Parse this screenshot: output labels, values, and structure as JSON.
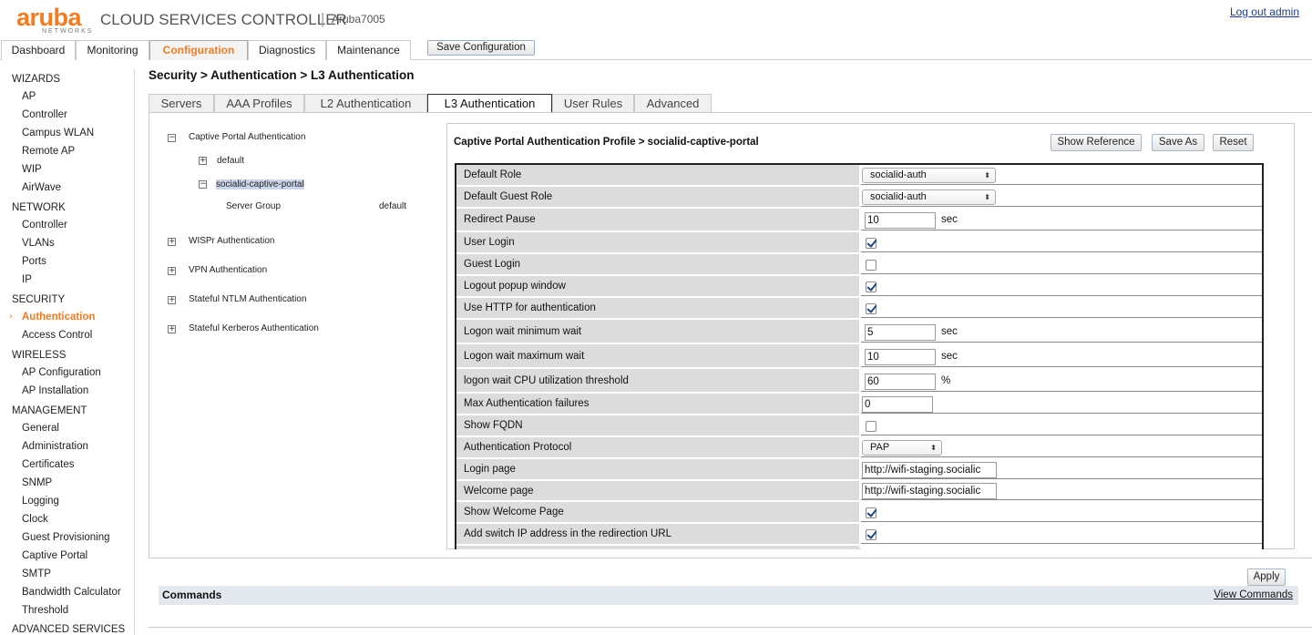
{
  "header": {
    "logo_text": "aruba",
    "logo_sub": "NETWORKS",
    "app_title": "CLOUD SERVICES CONTROLLER",
    "separator": "|",
    "device_name": "Aruba7005",
    "logout": "Log out admin"
  },
  "main_tabs": [
    "Dashboard",
    "Monitoring",
    "Configuration",
    "Diagnostics",
    "Maintenance"
  ],
  "active_main_tab": "Configuration",
  "save_configuration": "Save Configuration",
  "sidebar": {
    "sections": {
      "wizards": "WIZARDS",
      "network": "NETWORK",
      "security": "SECURITY",
      "wireless": "WIRELESS",
      "management": "MANAGEMENT",
      "advanced": "ADVANCED SERVICES"
    },
    "wizards": [
      "AP",
      "Controller",
      "Campus WLAN",
      "Remote AP",
      "WIP",
      "AirWave"
    ],
    "network": [
      "Controller",
      "VLANs",
      "Ports",
      "IP"
    ],
    "security": [
      "Authentication",
      "Access Control"
    ],
    "wireless": [
      "AP Configuration",
      "AP Installation"
    ],
    "management": [
      "General",
      "Administration",
      "Certificates",
      "SNMP",
      "Logging",
      "Clock",
      "Guest Provisioning",
      "Captive Portal",
      "SMTP",
      "Bandwidth Calculator",
      "Threshold"
    ],
    "arrow": "›"
  },
  "breadcrumb": "Security > Authentication > L3 Authentication",
  "sub_tabs": [
    "Servers",
    "AAA Profiles",
    "L2 Authentication",
    "L3 Authentication",
    "User Rules",
    "Advanced"
  ],
  "tree": {
    "captive_portal": "Captive Portal Authentication",
    "default": "default",
    "socialid": "socialid-captive-portal",
    "server_group_label": "Server Group",
    "server_group_value": "default",
    "wispr": "WISPr Authentication",
    "vpn": "VPN Authentication",
    "ntlm": "Stateful NTLM Authentication",
    "kerberos": "Stateful Kerberos Authentication",
    "minus": "−",
    "plus": "+"
  },
  "profile": {
    "title": "Captive Portal Authentication Profile > socialid-captive-portal",
    "show_reference": "Show Reference",
    "save_as": "Save As",
    "reset": "Reset",
    "rows": [
      {
        "label": "Default Role",
        "type": "select",
        "value": "socialid-auth"
      },
      {
        "label": "Default Guest Role",
        "type": "select",
        "value": "socialid-auth"
      },
      {
        "label": "Redirect Pause",
        "type": "text",
        "value": "10",
        "unit": "sec"
      },
      {
        "label": "User Login",
        "type": "checkbox",
        "checked": true
      },
      {
        "label": "Guest Login",
        "type": "checkbox",
        "checked": false
      },
      {
        "label": "Logout popup window",
        "type": "checkbox",
        "checked": true
      },
      {
        "label": "Use HTTP for authentication",
        "type": "checkbox",
        "checked": true
      },
      {
        "label": "Logon wait minimum wait",
        "type": "text",
        "value": "5",
        "unit": "sec"
      },
      {
        "label": "Logon wait maximum wait",
        "type": "text",
        "value": "10",
        "unit": "sec"
      },
      {
        "label": "logon wait CPU utilization threshold",
        "type": "text",
        "value": "60",
        "unit": "%"
      },
      {
        "label": "Max Authentication failures",
        "type": "text",
        "value": "0"
      },
      {
        "label": "Show FQDN",
        "type": "checkbox",
        "checked": false
      },
      {
        "label": "Authentication Protocol",
        "type": "select",
        "value": "PAP"
      },
      {
        "label": "Login page",
        "type": "text",
        "value": "http://wifi-staging.socialic"
      },
      {
        "label": "Welcome page",
        "type": "text",
        "value": "http://wifi-staging.socialic"
      },
      {
        "label": "Show Welcome Page",
        "type": "checkbox",
        "checked": true
      },
      {
        "label": "Add switch IP address in the redirection URL",
        "type": "checkbox",
        "checked": true
      }
    ],
    "select_arrow": "⬍"
  },
  "commands": {
    "apply": "Apply",
    "title": "Commands",
    "view": "View Commands"
  },
  "colors": {
    "accent": "#f47b20",
    "link": "#1a3d8f",
    "label_bg": "#dcdcdc"
  }
}
